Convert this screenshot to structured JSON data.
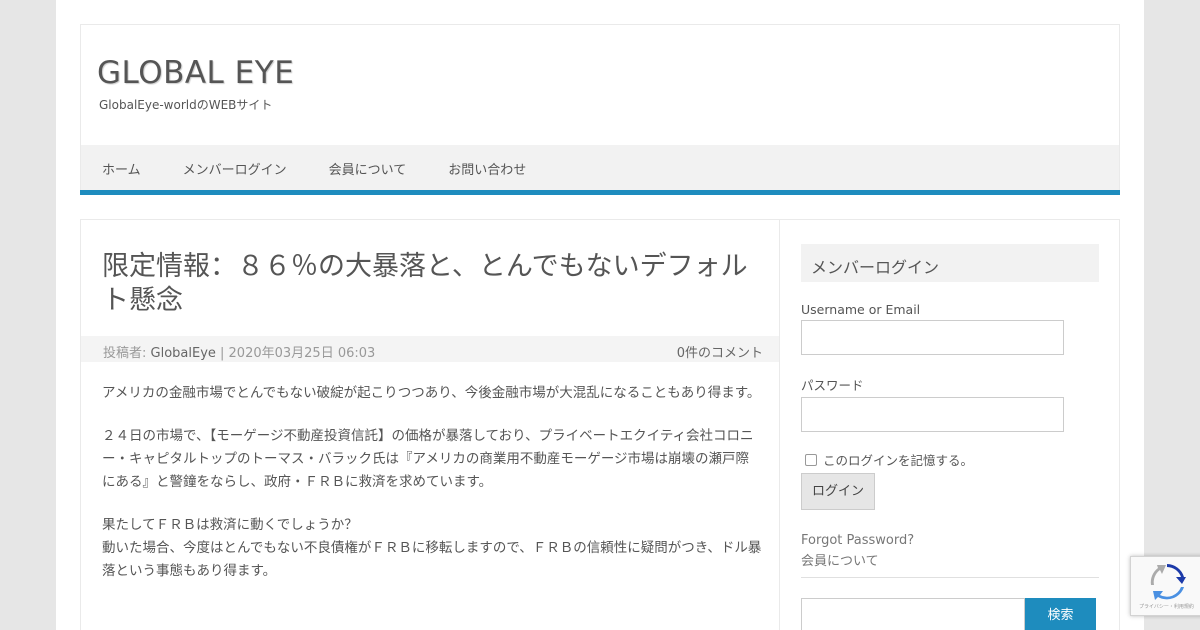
{
  "site": {
    "title": "GLOBAL EYE",
    "description": "GlobalEye-worldのWEBサイト"
  },
  "nav": {
    "items": [
      "ホーム",
      "メンバーログイン",
      "会員について",
      "お問い合わせ"
    ]
  },
  "post": {
    "title": "限定情報：８６％の大暴落と、とんでもないデフォルト懸念",
    "meta_prefix": "投稿者: ",
    "author": "GlobalEye",
    "date": " | 2020年03月25日 06:03",
    "comments": "0件のコメント",
    "paragraphs": [
      "アメリカの金融市場でとんでもない破綻が起こりつつあり、今後金融市場が大混乱になることもあり得ます。",
      "２４日の市場で、【モーゲージ不動産投資信託】の価格が暴落しており、プライベートエクイティ会社コロニー・キャピタルトップのトーマス・バラック氏は『アメリカの商業用不動産モーゲージ市場は崩壊の瀬戸際にある』と警鐘をならし、政府・ＦＲＢに救済を求めています。",
      "果たしてＦＲＢは救済に動くでしょうか？\n動いた場合、今度はとんでもない不良債権がＦＲＢに移転しますので、ＦＲＢの信頼性に疑問がつき、ドル暴落という事態もあり得ます。"
    ]
  },
  "sidebar": {
    "widget_title": "メンバーログイン",
    "username_label": "Username or Email",
    "password_label": "パスワード",
    "remember_label": "このログインを記憶する。",
    "login_button": "ログイン",
    "forgot_link": "Forgot Password?",
    "member_link": "会員について",
    "search_button": "検索"
  },
  "recaptcha": {
    "text": "プライバシー・利用規約"
  },
  "colors": {
    "accent": "#1e8cbe",
    "background": "#e6e6e6"
  }
}
